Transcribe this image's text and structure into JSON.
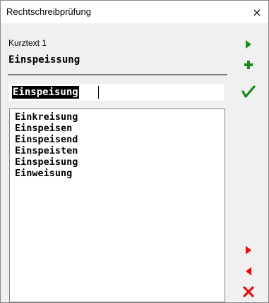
{
  "window": {
    "title": "Rechtschreibprüfung",
    "close_glyph": "×"
  },
  "field": {
    "label": "Kurztext 1",
    "original_word": "Einspeissung"
  },
  "replacement": {
    "value": "Einspeisung"
  },
  "suggestions": [
    "Einkreisung",
    "Einspeisen",
    "Einspeisend",
    "Einspeisten",
    "Einspeisung",
    "Einweisung"
  ],
  "buttons": {
    "next_icon": "play-right-icon",
    "add_icon": "plus-icon",
    "accept_icon": "checkmark-icon",
    "next_error_icon": "arrow-right-icon",
    "prev_error_icon": "arrow-left-icon",
    "cancel_icon": "x-icon"
  },
  "colors": {
    "green": "#1a8a1a",
    "red": "#e01010"
  }
}
